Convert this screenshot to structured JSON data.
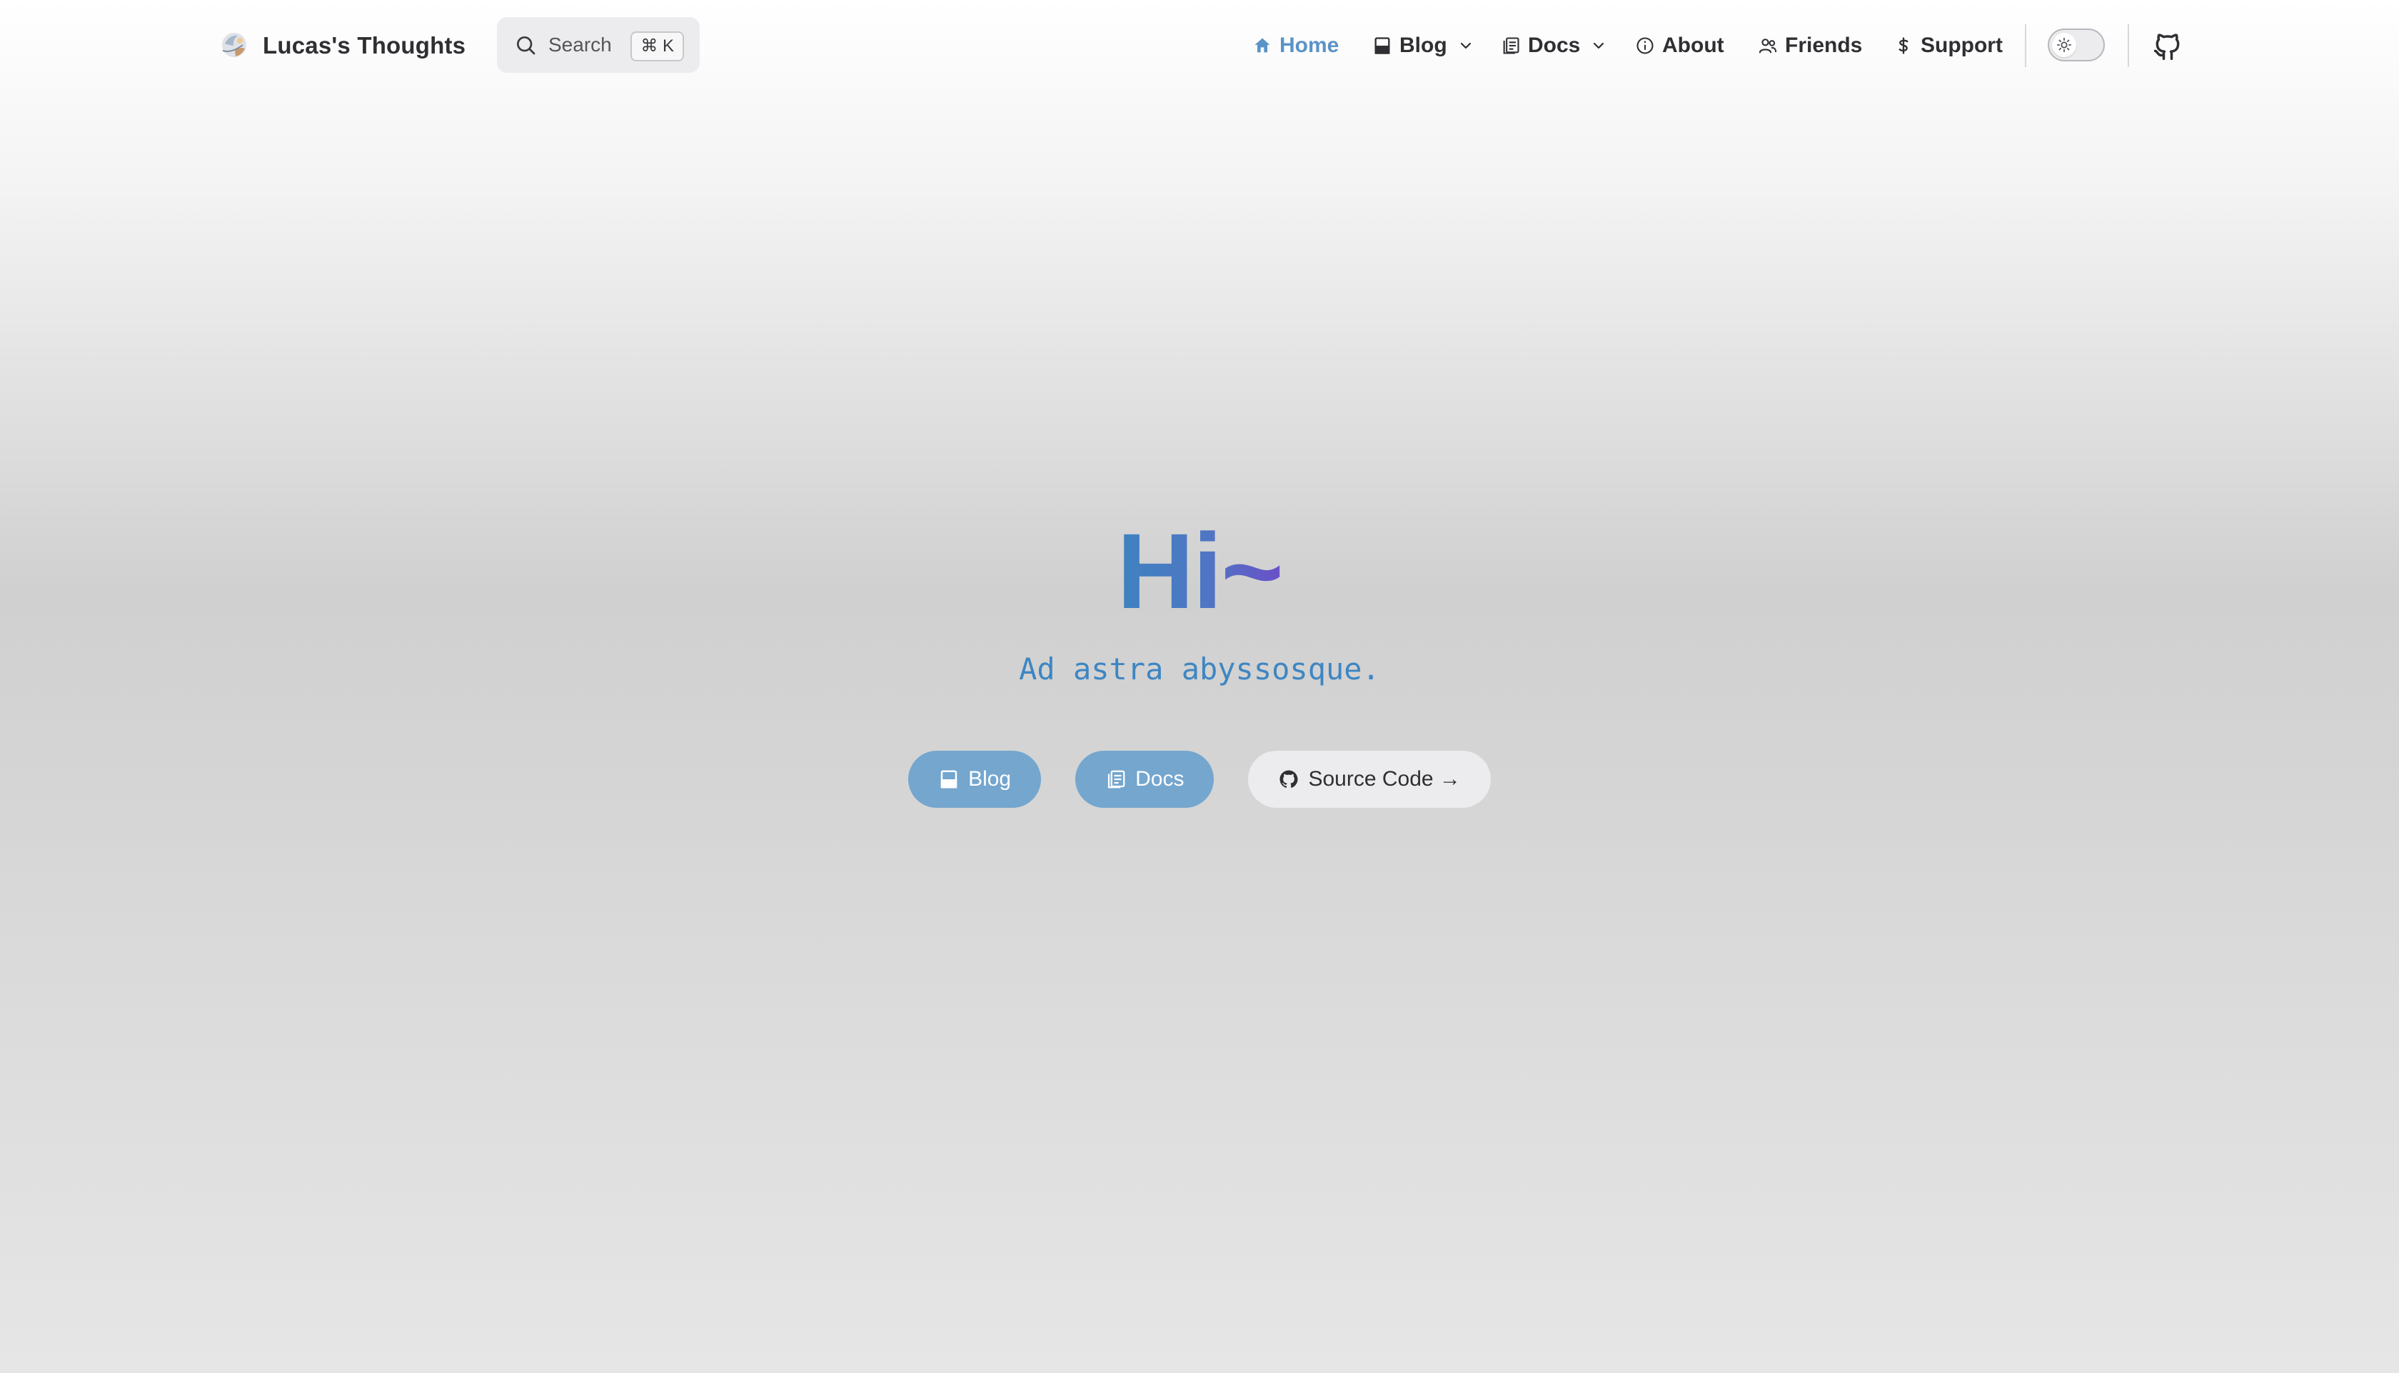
{
  "site": {
    "name": "Lucas's Thoughts"
  },
  "search": {
    "placeholder": "Search",
    "shortcut": "⌘ K"
  },
  "nav": {
    "items": [
      {
        "label": "Home",
        "icon": "home-icon",
        "active": true
      },
      {
        "label": "Blog",
        "icon": "blog-icon",
        "dropdown": true
      },
      {
        "label": "Docs",
        "icon": "docs-icon",
        "dropdown": true
      },
      {
        "label": "About",
        "icon": "info-icon"
      },
      {
        "label": "Friends",
        "icon": "friends-icon"
      },
      {
        "label": "Support",
        "icon": "dollar-icon"
      }
    ]
  },
  "theme": {
    "mode": "light",
    "icon": "sun-icon"
  },
  "hero": {
    "title": "Hi~",
    "tagline": "Ad astra abyssosque.",
    "actions": [
      {
        "label": "Blog",
        "icon": "blog-icon",
        "style": "brand"
      },
      {
        "label": "Docs",
        "icon": "docs-icon",
        "style": "brand"
      },
      {
        "label": "Source Code →",
        "icon": "github-icon",
        "style": "alt"
      }
    ]
  },
  "colors": {
    "accent": "#5a93c7",
    "brand_button": "#74a6ce",
    "tagline": "#3e86c2",
    "title_gradient_start": "#3f82c0",
    "title_gradient_end": "#6a4fc8"
  }
}
